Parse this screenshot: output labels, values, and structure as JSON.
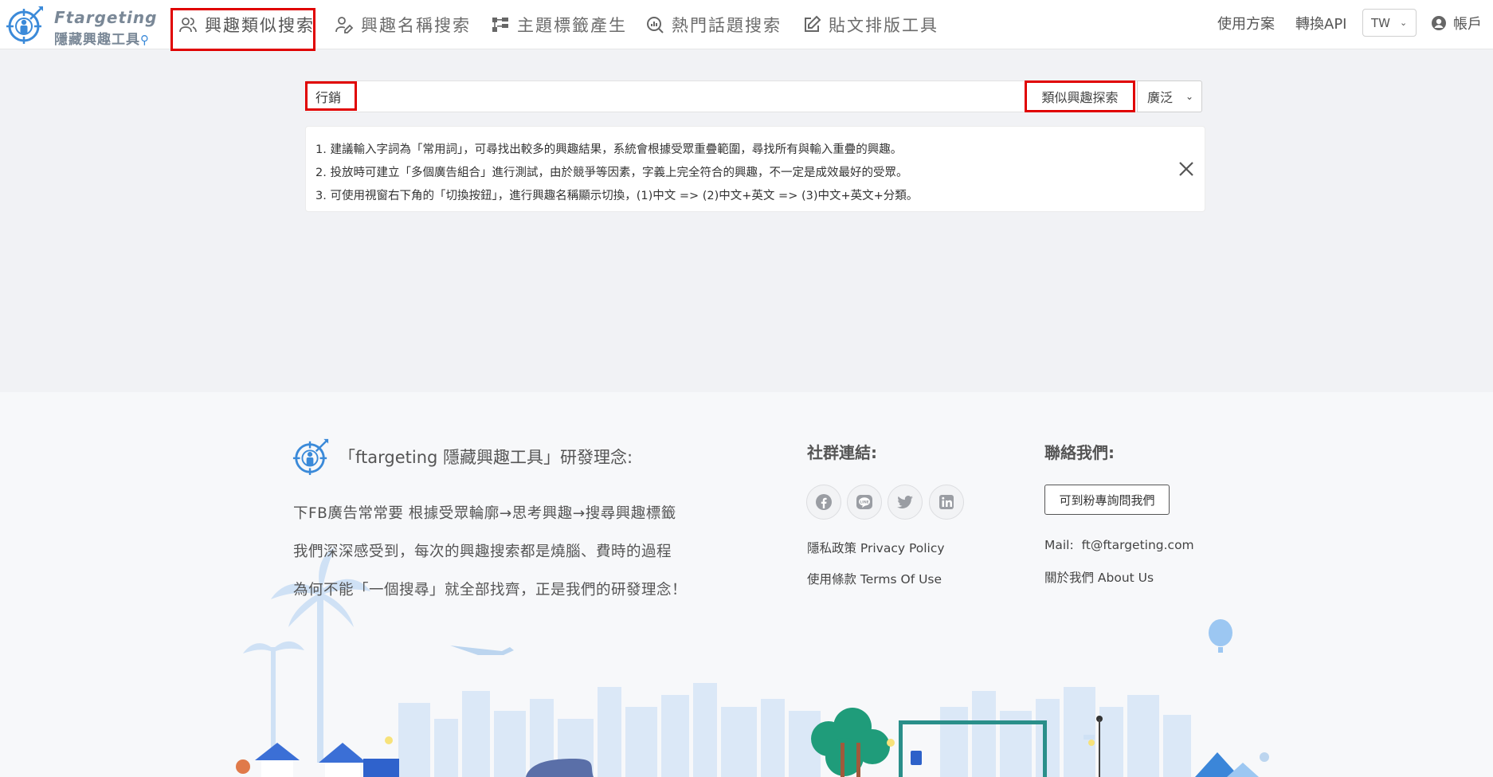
{
  "brand": {
    "title": "Ftargeting",
    "subtitle": "隱藏興趣工具",
    "subtitle_icon": "magnifier-icon"
  },
  "nav": {
    "items": [
      {
        "label": "興趣類似搜索",
        "icon": "users-icon",
        "active": true
      },
      {
        "label": "興趣名稱搜索",
        "icon": "user-edit-icon",
        "active": false
      },
      {
        "label": "主題標籤產生",
        "icon": "sitemap-icon",
        "active": false
      },
      {
        "label": "熱門話題搜索",
        "icon": "trend-search-icon",
        "active": false
      },
      {
        "label": "貼文排版工具",
        "icon": "edit-icon",
        "active": false
      }
    ],
    "plans": "使用方案",
    "api": "轉換API",
    "language": "TW",
    "account": "帳戶"
  },
  "search": {
    "value": "行銷",
    "placeholder": "",
    "button_label": "類似興趣探索",
    "mode": "廣泛"
  },
  "tips": [
    "1. 建議輸入字詞為「常用詞」，可尋找出較多的興趣結果，系統會根據受眾重疊範圍，尋找所有與輸入重疊的興趣。",
    "2. 投放時可建立「多個廣告組合」進行測試，由於競爭等因素，字義上完全符合的興趣，不一定是成效最好的受眾。",
    "3. 可使用視窗右下角的「切換按鈕」，進行興趣名稱顯示切換，(1)中文 => (2)中文+英文 => (3)中文+英文+分類。"
  ],
  "footer": {
    "philosophy_title": "「ftargeting 隱藏興趣工具」研發理念:",
    "philosophy_lines": [
      "下FB廣告常常要 根據受眾輪廓→思考興趣→搜尋興趣標籤",
      "我們深深感受到，每次的興趣搜索都是燒腦、費時的過程",
      "為何不能「一個搜尋」就全部找齊，正是我們的研發理念！"
    ],
    "social_heading": "社群連結:",
    "social_icons": [
      "facebook-icon",
      "line-icon",
      "twitter-icon",
      "linkedin-icon"
    ],
    "privacy": "隱私政策 Privacy Policy",
    "terms": "使用條款 Terms Of Use",
    "contact_heading": "聯絡我們:",
    "fan_button": "可到粉專詢問我們",
    "mail_label": "Mail:",
    "mail": "ft@ftargeting.com",
    "about": "關於我們 About Us"
  },
  "colors": {
    "highlight": "#e00000",
    "brand_blue": "#3b8ad9",
    "page_bg": "#f1f2f5",
    "footer_bg": "#f7f8fa"
  }
}
